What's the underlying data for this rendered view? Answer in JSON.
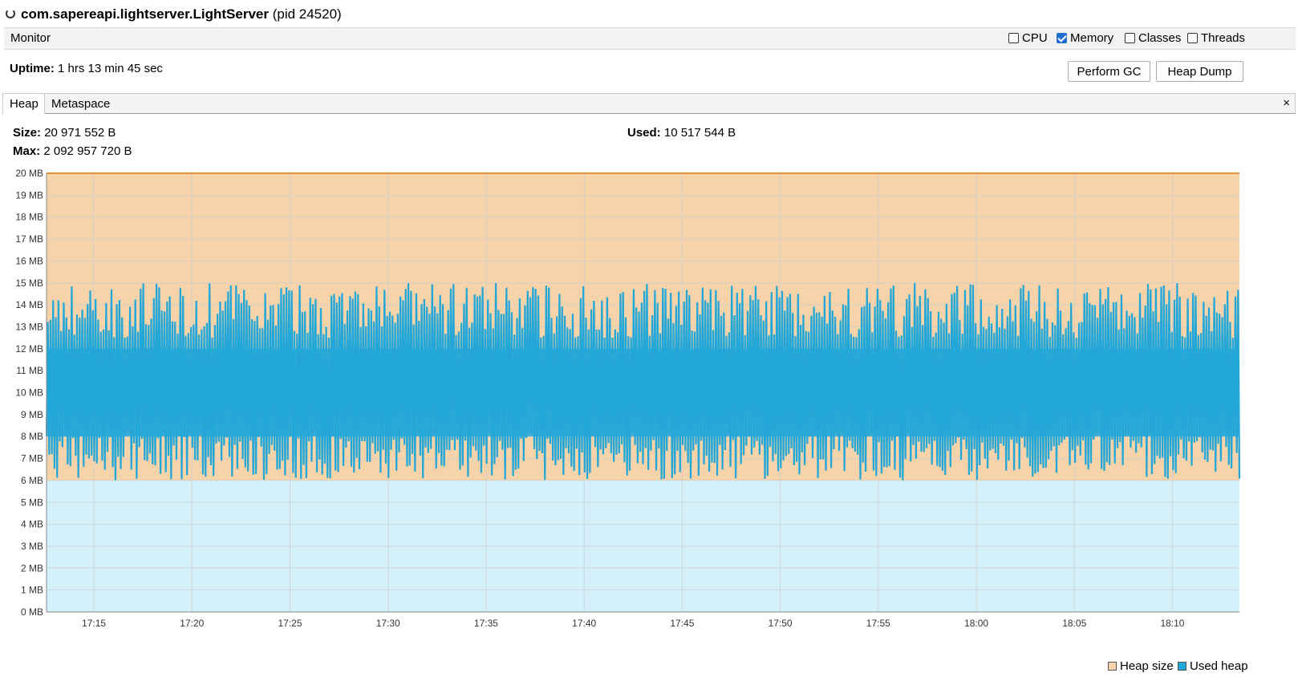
{
  "header": {
    "app_name": "com.sapereapi.lightserver.LightServer",
    "pid_text": "(pid 24520)"
  },
  "monitor": {
    "label": "Monitor",
    "checkboxes": [
      {
        "label": "CPU",
        "checked": false
      },
      {
        "label": "Memory",
        "checked": true
      },
      {
        "label": "Classes",
        "checked": false
      },
      {
        "label": "Threads",
        "checked": false
      }
    ]
  },
  "uptime": {
    "label": "Uptime:",
    "value": "1 hrs 13 min 45 sec"
  },
  "buttons": {
    "perform_gc": "Perform GC",
    "heap_dump": "Heap Dump"
  },
  "tabs": [
    {
      "label": "Heap"
    },
    {
      "label": "Metaspace"
    }
  ],
  "close_glyph": "×",
  "stats": {
    "size_label": "Size:",
    "size_value": "20 971 552 B",
    "used_label": "Used:",
    "used_value": "10 517 544 B",
    "max_label": "Max:",
    "max_value": "2 092 957 720 B"
  },
  "colors": {
    "heap_size_fill": "#f6d3a8",
    "heap_size_line": "#e8913a",
    "used_heap": "#22a7d8",
    "used_heap_bg": "#d4f0fa"
  },
  "chart_data": {
    "type": "area",
    "ylim": [
      0,
      20
    ],
    "y_ticks": [
      "0 MB",
      "1 MB",
      "2 MB",
      "3 MB",
      "4 MB",
      "5 MB",
      "6 MB",
      "7 MB",
      "8 MB",
      "9 MB",
      "10 MB",
      "11 MB",
      "12 MB",
      "13 MB",
      "14 MB",
      "15 MB",
      "16 MB",
      "17 MB",
      "18 MB",
      "19 MB",
      "20 MB"
    ],
    "x_ticks": [
      "17:15",
      "17:20",
      "17:25",
      "17:30",
      "17:35",
      "17:40",
      "17:45",
      "17:50",
      "17:55",
      "18:00",
      "18:05",
      "18:10"
    ],
    "xlim": [
      "17:12:35",
      "18:13:25"
    ],
    "grid": true,
    "legend_position": "bottom-right",
    "series": [
      {
        "name": "Heap size",
        "values": [
          20,
          20
        ]
      },
      {
        "name": "Used heap",
        "x": [
          "17:12:35",
          "17:15",
          "17:20",
          "17:25",
          "17:30",
          "17:35",
          "17:40",
          "17:45",
          "17:50",
          "17:55",
          "18:00",
          "18:05",
          "18:10",
          "18:13:25"
        ],
        "values": [
          10,
          10,
          10,
          10,
          10,
          10,
          10,
          10,
          10,
          10,
          10,
          10,
          10,
          10
        ]
      }
    ]
  },
  "legend": [
    {
      "label": "Heap size"
    },
    {
      "label": "Used heap"
    }
  ]
}
